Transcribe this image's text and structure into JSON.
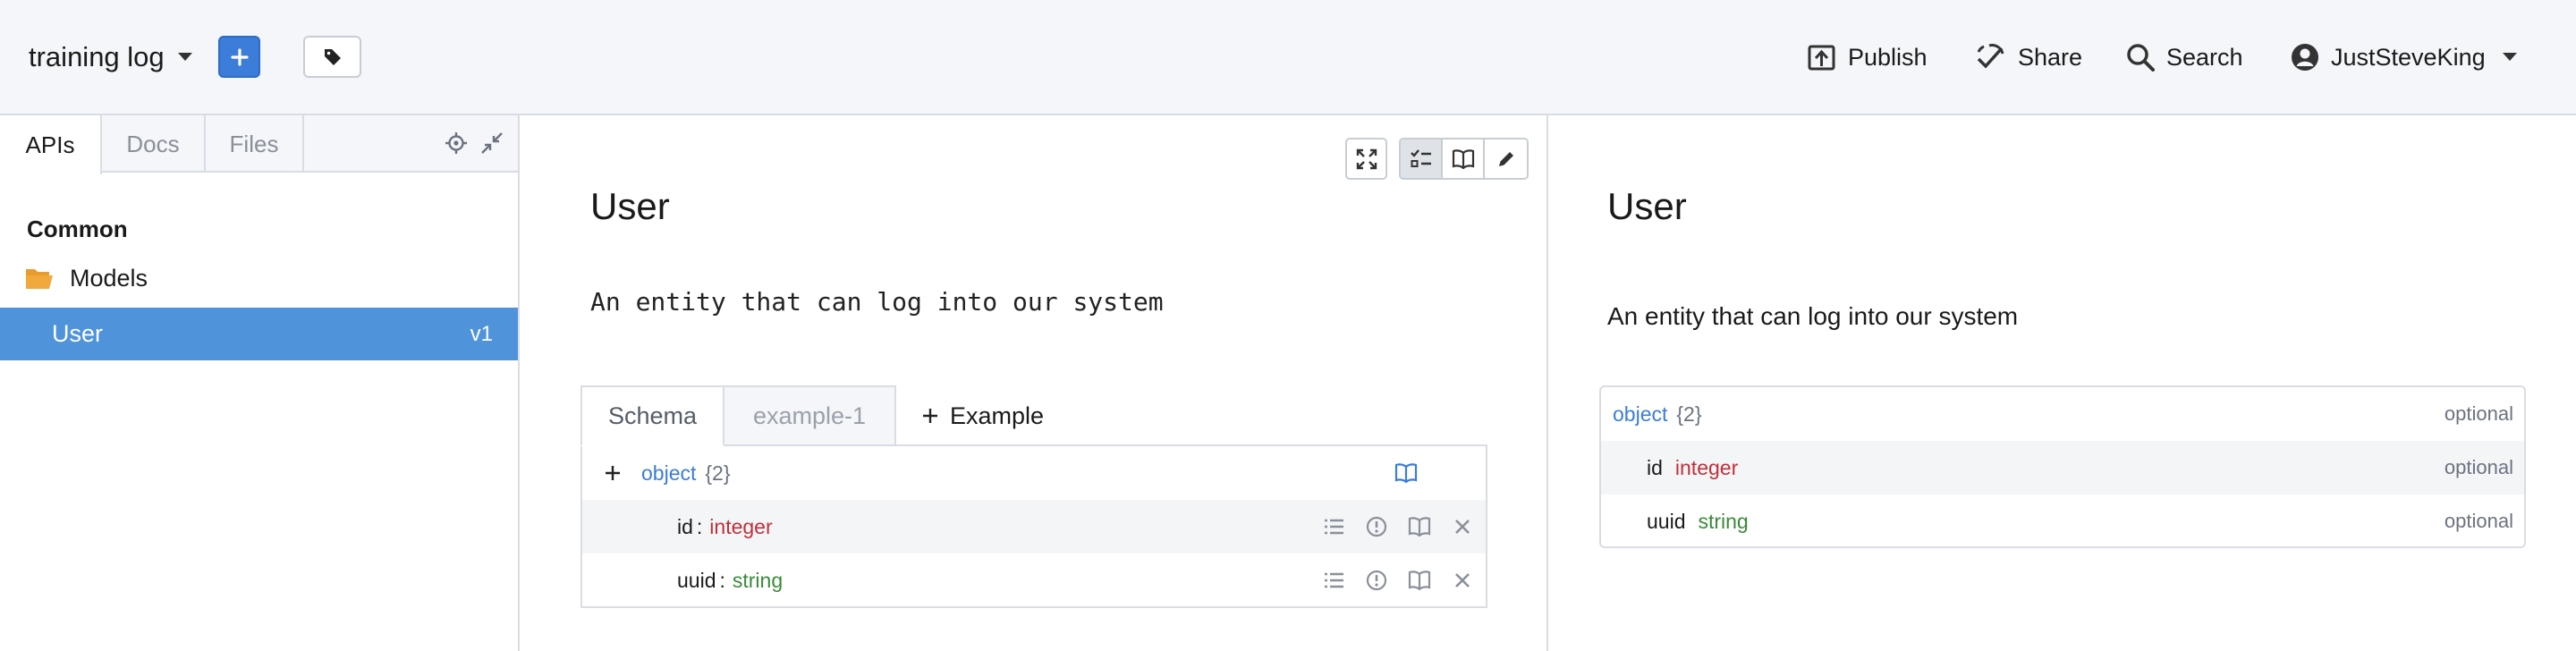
{
  "topbar": {
    "project_name": "training log",
    "actions": {
      "publish": "Publish",
      "share": "Share",
      "search": "Search",
      "user": "JustSteveKing"
    }
  },
  "sidebar": {
    "tabs": [
      "APIs",
      "Docs",
      "Files"
    ],
    "active_tab": "APIs",
    "section": "Common",
    "folder": "Models",
    "selected_item": {
      "label": "User",
      "version": "v1"
    }
  },
  "editor": {
    "title": "User",
    "description": "An entity that can log into our system",
    "tabs": {
      "schema": "Schema",
      "example": "example-1",
      "add_example": "Example"
    },
    "schema": {
      "root_type": "object",
      "root_count": "{2}",
      "properties": [
        {
          "name": "id",
          "type": "integer"
        },
        {
          "name": "uuid",
          "type": "string"
        }
      ]
    }
  },
  "preview": {
    "title": "User",
    "description": "An entity that can log into our system",
    "root_type": "object",
    "root_count": "{2}",
    "optional_label": "optional",
    "properties": [
      {
        "name": "id",
        "type": "integer"
      },
      {
        "name": "uuid",
        "type": "string"
      }
    ]
  },
  "colors": {
    "accent": "#3b7dd8",
    "selection": "#4f93db",
    "integer_type": "#c0303b",
    "string_type": "#3a8a3a",
    "folder": "#f2a93b"
  }
}
